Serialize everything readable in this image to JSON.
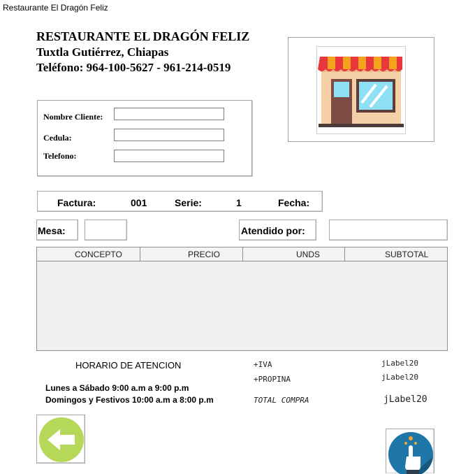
{
  "window": {
    "title": "Restaurante El Dragón Feliz"
  },
  "header": {
    "name": "RESTAURANTE EL DRAGÓN FELIZ",
    "city": "Tuxtla Gutiérrez, Chiapas",
    "phone": "Teléfono: 964-100-5627 - 961-214-0519"
  },
  "client_form": {
    "nombre_label": "Nombre Cliente:",
    "cedula_label": "Cedula:",
    "telefono_label": "Telefono:",
    "nombre_value": "",
    "cedula_value": "",
    "telefono_value": ""
  },
  "invoice": {
    "factura_label": "Factura:",
    "factura_value": "001",
    "serie_label": "Serie:",
    "serie_value": "1",
    "fecha_label": "Fecha:",
    "fecha_value": "",
    "mesa_label": "Mesa:",
    "mesa_value": "",
    "atendido_label": "Atendido por:",
    "atendido_value": ""
  },
  "table": {
    "columns": [
      "CONCEPTO",
      "PRECIO",
      "UNDS",
      "SUBTOTAL"
    ],
    "rows": []
  },
  "schedule": {
    "title": "HORARIO DE ATENCION",
    "line1": "Lunes a Sábado 9:00 a.m a 9:00 p.m",
    "line2": "Domingos y Festivos 10:00 a.m a 8:00 p.m"
  },
  "totals": {
    "iva_label": "+IVA",
    "iva_value": "jLabel20",
    "propina_label": "+PROPINA",
    "propina_value": "jLabel20",
    "total_label": "TOTAL COMPRA",
    "total_value": "jLabel20"
  },
  "icons": {
    "back": "back-arrow-icon",
    "touch": "touch-hand-icon",
    "store": "store-front-icon"
  },
  "colors": {
    "back_green": "#b5d75a",
    "touch_blue": "#1f76a8",
    "awning_red": "#e8383d"
  }
}
